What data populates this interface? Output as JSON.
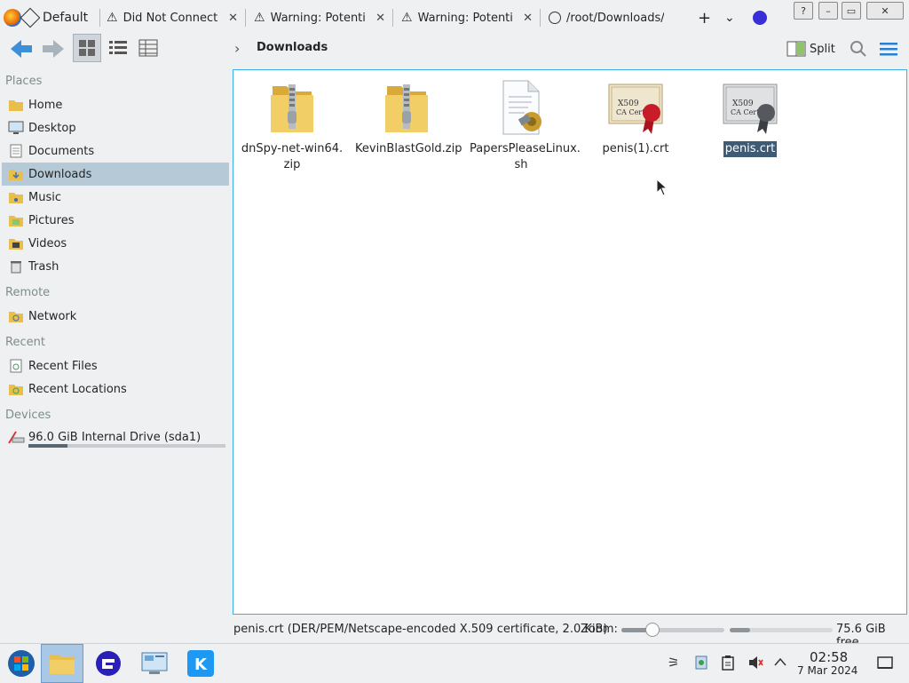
{
  "browser": {
    "tabs": [
      {
        "label": "Default"
      },
      {
        "label": "Did Not Connect"
      },
      {
        "label": "Warning: Potential"
      },
      {
        "label": "Warning: Potential"
      },
      {
        "label": "/root/Downloads/p"
      }
    ],
    "new_tab": "+",
    "list_tabs": "⌄",
    "close_glyph": "✕"
  },
  "window_controls": {
    "help": "?",
    "minimize": "–",
    "maximize": "▭",
    "close": "✕"
  },
  "toolbar": {
    "breadcrumb_separator": "›",
    "breadcrumb": "Downloads",
    "split_label": "Split"
  },
  "sidebar": {
    "sections": [
      {
        "title": "Places",
        "items": [
          {
            "label": "Home",
            "icon": "home-folder-icon"
          },
          {
            "label": "Desktop",
            "icon": "desktop-icon"
          },
          {
            "label": "Documents",
            "icon": "documents-icon"
          },
          {
            "label": "Downloads",
            "icon": "downloads-folder-icon",
            "active": true
          },
          {
            "label": "Music",
            "icon": "music-folder-icon"
          },
          {
            "label": "Pictures",
            "icon": "pictures-folder-icon"
          },
          {
            "label": "Videos",
            "icon": "videos-folder-icon"
          },
          {
            "label": "Trash",
            "icon": "trash-icon"
          }
        ]
      },
      {
        "title": "Remote",
        "items": [
          {
            "label": "Network",
            "icon": "network-folder-icon"
          }
        ]
      },
      {
        "title": "Recent",
        "items": [
          {
            "label": "Recent Files",
            "icon": "recent-files-icon"
          },
          {
            "label": "Recent Locations",
            "icon": "recent-locations-icon"
          }
        ]
      },
      {
        "title": "Devices",
        "items": [
          {
            "label": "96.0 GiB Internal Drive (sda1)",
            "icon": "drive-icon",
            "usage_fraction": 0.2
          }
        ]
      }
    ]
  },
  "files": [
    {
      "name_line1": "dnSpy-net-win64.",
      "name_line2": "zip",
      "icon": "zip-folder-icon"
    },
    {
      "name_line1": "KevinBlastGold.zip",
      "name_line2": "",
      "icon": "zip-folder-icon"
    },
    {
      "name_line1": "PapersPleaseLinux.",
      "name_line2": "sh",
      "icon": "script-file-icon"
    },
    {
      "name_line1": "penis(1).crt",
      "name_line2": "",
      "icon": "certificate-red-icon"
    },
    {
      "name_line1": "penis.crt",
      "name_line2": "",
      "icon": "certificate-gray-icon",
      "selected": true
    }
  ],
  "status": {
    "info": "penis.crt (DER/PEM/Netscape-encoded X.509 certificate, 2.0 KiB)",
    "zoom_label": "Zoom:",
    "zoom_fraction": 0.3,
    "free_fraction": 0.2,
    "free_label": "75.6 GiB free"
  },
  "taskbar": {
    "time": "02:58",
    "date": "7 Mar 2024"
  },
  "colors": {
    "accent": "#3daee9",
    "selection": "#3d5b74",
    "sidebar_active": "#b6c9d7"
  }
}
